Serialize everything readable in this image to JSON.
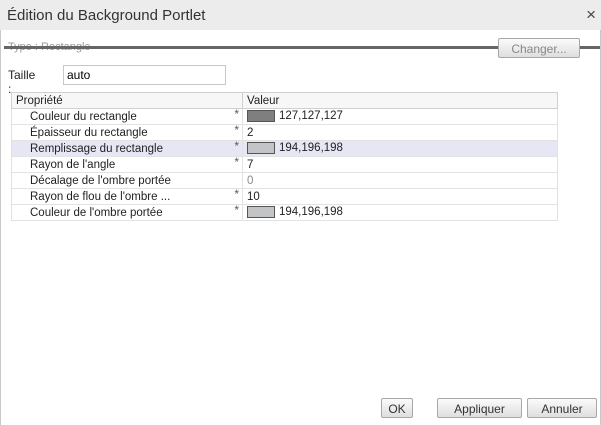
{
  "dialog": {
    "title": "Édition du Background Portlet",
    "close_glyph": "×"
  },
  "type_row": {
    "label": "Type : Rectangle",
    "change_button": "Changer..."
  },
  "size": {
    "label": "Taille :",
    "value": "auto"
  },
  "grid": {
    "headers": [
      "Propriété",
      "Valeur"
    ],
    "rows": [
      {
        "name": "Couleur du rectangle",
        "star": "*",
        "value": "127,127,127",
        "swatch": "#7f7f7f"
      },
      {
        "name": "Épaisseur du rectangle",
        "star": "*",
        "value": "2"
      },
      {
        "name": "Remplissage du rectangle",
        "star": "*",
        "value": "194,196,198",
        "swatch": "#c2c4c6"
      },
      {
        "name": "Rayon de l'angle",
        "star": "*",
        "value": "7"
      },
      {
        "name": "Décalage de l'ombre portée",
        "star": "",
        "value": "0"
      },
      {
        "name": "Rayon de flou de l'ombre ...",
        "star": "*",
        "value": "10"
      },
      {
        "name": "Couleur de l'ombre portée",
        "star": "*",
        "value": "194,196,198",
        "swatch": "#c2c4c6"
      }
    ]
  },
  "buttons": {
    "ok": "OK",
    "apply": "Appliquer",
    "cancel": "Annuler"
  }
}
